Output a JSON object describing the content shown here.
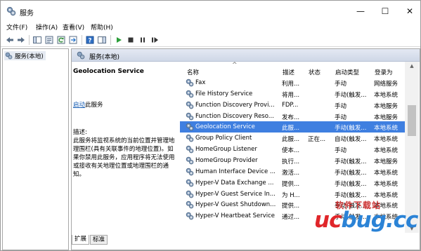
{
  "window": {
    "title": "服务",
    "controls": {
      "minimize": "—",
      "maximize": "☐",
      "close": "✕"
    }
  },
  "menu": [
    "文件(F)",
    "操作(A)",
    "查看(V)",
    "帮助(H)"
  ],
  "toolbar": {
    "icons": [
      "back-arrow-icon",
      "forward-arrow-icon",
      "console-tree-icon",
      "properties-icon",
      "refresh-icon",
      "export-list-icon",
      "help-icon",
      "show-hide-pane-icon",
      "start-service-icon",
      "stop-service-icon",
      "pause-service-icon",
      "restart-service-icon"
    ]
  },
  "tree": {
    "item_label": "服务(本地)"
  },
  "right_header": {
    "title": "服务(本地)"
  },
  "details": {
    "service_title": "Geolocation Service",
    "start_link": "启动",
    "start_suffix": "此服务",
    "desc_label": "描述:",
    "desc_text": "此服务将监视系统的当前位置并管理地理围栏(具有关联事件的地理位置)。如果你禁用此服务，应用程序将无法使用或接收有关地理位置或地理围栏的通知。"
  },
  "columns": {
    "name": "名称",
    "description": "描述",
    "status": "状态",
    "startup": "启动类型",
    "logon": "登录为"
  },
  "rows": [
    {
      "name": "Fax",
      "description": "利用...",
      "status": "",
      "startup": "手动",
      "logon": "网络服务"
    },
    {
      "name": "File History Service",
      "description": "将用...",
      "status": "",
      "startup": "手动(触发...",
      "logon": "本地系统"
    },
    {
      "name": "Function Discovery Provi...",
      "description": "FDP...",
      "status": "",
      "startup": "手动",
      "logon": "本地服务"
    },
    {
      "name": "Function Discovery Reso...",
      "description": "发布...",
      "status": "",
      "startup": "手动",
      "logon": "本地服务"
    },
    {
      "name": "Geolocation Service",
      "description": "此服...",
      "status": "",
      "startup": "手动(触发...",
      "logon": "本地系统"
    },
    {
      "name": "Group Policy Client",
      "description": "此服...",
      "status": "正在...",
      "startup": "自动(触发...",
      "logon": "本地系统"
    },
    {
      "name": "HomeGroup Listener",
      "description": "使本...",
      "status": "",
      "startup": "手动",
      "logon": "本地系统"
    },
    {
      "name": "HomeGroup Provider",
      "description": "执行...",
      "status": "",
      "startup": "手动(触发...",
      "logon": "本地服务"
    },
    {
      "name": "Human Interface Device ...",
      "description": "激活...",
      "status": "",
      "startup": "手动(触发...",
      "logon": "本地系统"
    },
    {
      "name": "Hyper-V Data Exchange ...",
      "description": "提供...",
      "status": "",
      "startup": "手动(触发...",
      "logon": "本地系统"
    },
    {
      "name": "Hyper-V Guest Service In...",
      "description": "为 H...",
      "status": "",
      "startup": "手动(触发...",
      "logon": "本地系统"
    },
    {
      "name": "Hyper-V Guest Shutdown...",
      "description": "提供...",
      "status": "",
      "startup": "手动(触发...",
      "logon": "本地系统"
    },
    {
      "name": "Hyper-V Heartbeat Service",
      "description": "通过...",
      "status": "",
      "startup": "手动(触发...",
      "logon": "本地系统"
    }
  ],
  "selected_row": 4,
  "tabs": [
    "扩展",
    "标准"
  ],
  "watermark": {
    "top_text": "软件下载站",
    "brand_uc": "uc",
    "brand_rest": "bug",
    "brand_suffix": ".cc"
  },
  "colors": {
    "selection": "#3f7fe0",
    "link": "#1a5fb4",
    "watermark_red": "#e0262a",
    "watermark_blue": "#2b83d6"
  }
}
